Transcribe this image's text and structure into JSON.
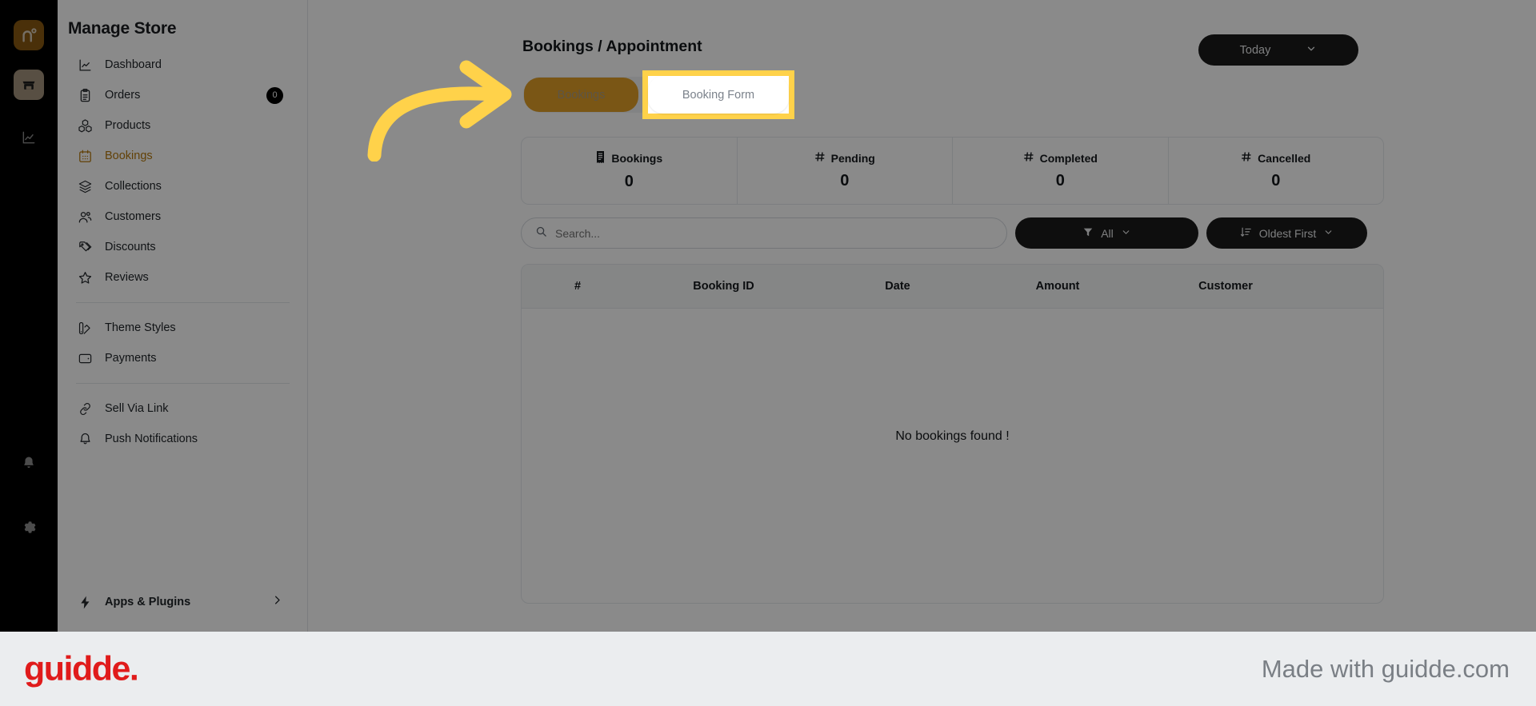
{
  "rail": {
    "logo_icon": "nuvio-logo-icon",
    "tiles": [
      {
        "icon": "storefront-icon",
        "name": "rail-store-tile"
      },
      {
        "icon": "analytics-chart-icon",
        "name": "rail-analytics-icon"
      }
    ],
    "bottom": [
      {
        "icon": "bell-icon",
        "name": "rail-notifications-icon"
      },
      {
        "icon": "gear-icon",
        "name": "rail-settings-icon"
      }
    ]
  },
  "sidebar": {
    "title": "Manage Store",
    "groups": [
      {
        "items": [
          {
            "label": "Dashboard",
            "icon": "line-chart-icon",
            "active": false,
            "badge": null
          },
          {
            "label": "Orders",
            "icon": "clipboard-icon",
            "active": false,
            "badge": "0"
          },
          {
            "label": "Products",
            "icon": "boxes-icon",
            "active": false,
            "badge": null
          },
          {
            "label": "Bookings",
            "icon": "calendar-icon",
            "active": true,
            "badge": null
          },
          {
            "label": "Collections",
            "icon": "layers-icon",
            "active": false,
            "badge": null
          },
          {
            "label": "Customers",
            "icon": "users-icon",
            "active": false,
            "badge": null
          },
          {
            "label": "Discounts",
            "icon": "tag-icon",
            "active": false,
            "badge": null
          },
          {
            "label": "Reviews",
            "icon": "star-icon",
            "active": false,
            "badge": null
          }
        ]
      },
      {
        "items": [
          {
            "label": "Theme Styles",
            "icon": "palette-icon",
            "active": false,
            "badge": null
          },
          {
            "label": "Payments",
            "icon": "wallet-icon",
            "active": false,
            "badge": null
          }
        ]
      },
      {
        "items": [
          {
            "label": "Sell Via Link",
            "icon": "link-icon",
            "active": false,
            "badge": null
          },
          {
            "label": "Push Notifications",
            "icon": "bell-icon",
            "active": false,
            "badge": null
          }
        ]
      }
    ],
    "footer_item": {
      "label": "Apps & Plugins",
      "icon": "bolt-icon",
      "chevron": "chevron-right-icon"
    }
  },
  "main": {
    "page_title": "Bookings / Appointment",
    "today_button": {
      "label": "Today",
      "chevron": "chevron-down-icon"
    },
    "tabs": [
      {
        "label": "Bookings",
        "active": true
      },
      {
        "label": "Booking Form",
        "active": false
      }
    ],
    "stats": [
      {
        "icon": "receipt-icon",
        "label": "Bookings",
        "value": "0"
      },
      {
        "icon": "hash-icon",
        "label": "Pending",
        "value": "0"
      },
      {
        "icon": "hash-icon",
        "label": "Completed",
        "value": "0"
      },
      {
        "icon": "hash-icon",
        "label": "Cancelled",
        "value": "0"
      }
    ],
    "search": {
      "placeholder": "Search...",
      "value": "",
      "icon": "search-icon"
    },
    "filter_button": {
      "label": "All",
      "icon": "funnel-icon",
      "chevron": "chevron-down-icon"
    },
    "sort_button": {
      "label": "Oldest First",
      "icon": "sort-descending-icon",
      "chevron": "chevron-down-icon"
    },
    "table": {
      "columns": [
        "#",
        "Booking ID",
        "Date",
        "Amount",
        "Customer"
      ],
      "rows": [],
      "empty_message": "No bookings found !"
    }
  },
  "annotation": {
    "highlighted_tab_label": "Booking Form",
    "obscured_tab_label": "Bookings",
    "arrow_icon": "curved-arrow-right-icon",
    "highlight_color": "#FFD24A"
  },
  "footer": {
    "logo_text": "guidde.",
    "tagline": "Made with guidde.com",
    "logo_color": "#e01b1b"
  }
}
